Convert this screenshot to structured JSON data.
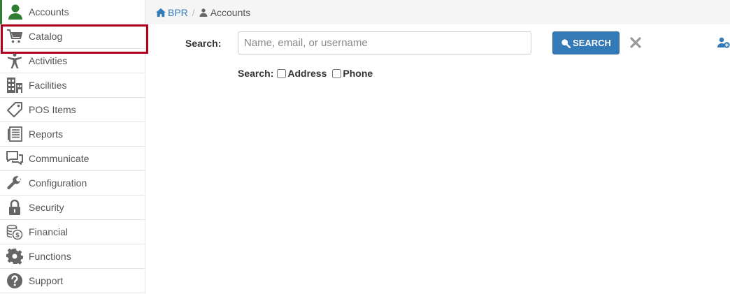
{
  "sidebar": {
    "items": [
      {
        "label": "Accounts",
        "icon": "user-icon"
      },
      {
        "label": "Catalog",
        "icon": "cart-icon"
      },
      {
        "label": "Activities",
        "icon": "person-figure-icon"
      },
      {
        "label": "Facilities",
        "icon": "building-icon"
      },
      {
        "label": "POS Items",
        "icon": "tag-icon"
      },
      {
        "label": "Reports",
        "icon": "reports-icon"
      },
      {
        "label": "Communicate",
        "icon": "chat-icon"
      },
      {
        "label": "Configuration",
        "icon": "wrench-icon"
      },
      {
        "label": "Security",
        "icon": "lock-icon"
      },
      {
        "label": "Financial",
        "icon": "coins-icon"
      },
      {
        "label": "Functions",
        "icon": "gear-icon"
      },
      {
        "label": "Support",
        "icon": "question-icon"
      }
    ],
    "active_color": "#2e7d32",
    "highlight_color": "#b3001e"
  },
  "breadcrumb": {
    "home": "BPR",
    "separator": "/",
    "current": "Accounts"
  },
  "search": {
    "label": "Search:",
    "placeholder": "Name, email, or username",
    "value": "",
    "button_label": "SEARCH",
    "options_label": "Search:",
    "options": [
      {
        "label": "Address",
        "checked": false
      },
      {
        "label": "Phone",
        "checked": false
      }
    ]
  },
  "colors": {
    "primary": "#337ab7",
    "icon_gray": "#666666"
  }
}
